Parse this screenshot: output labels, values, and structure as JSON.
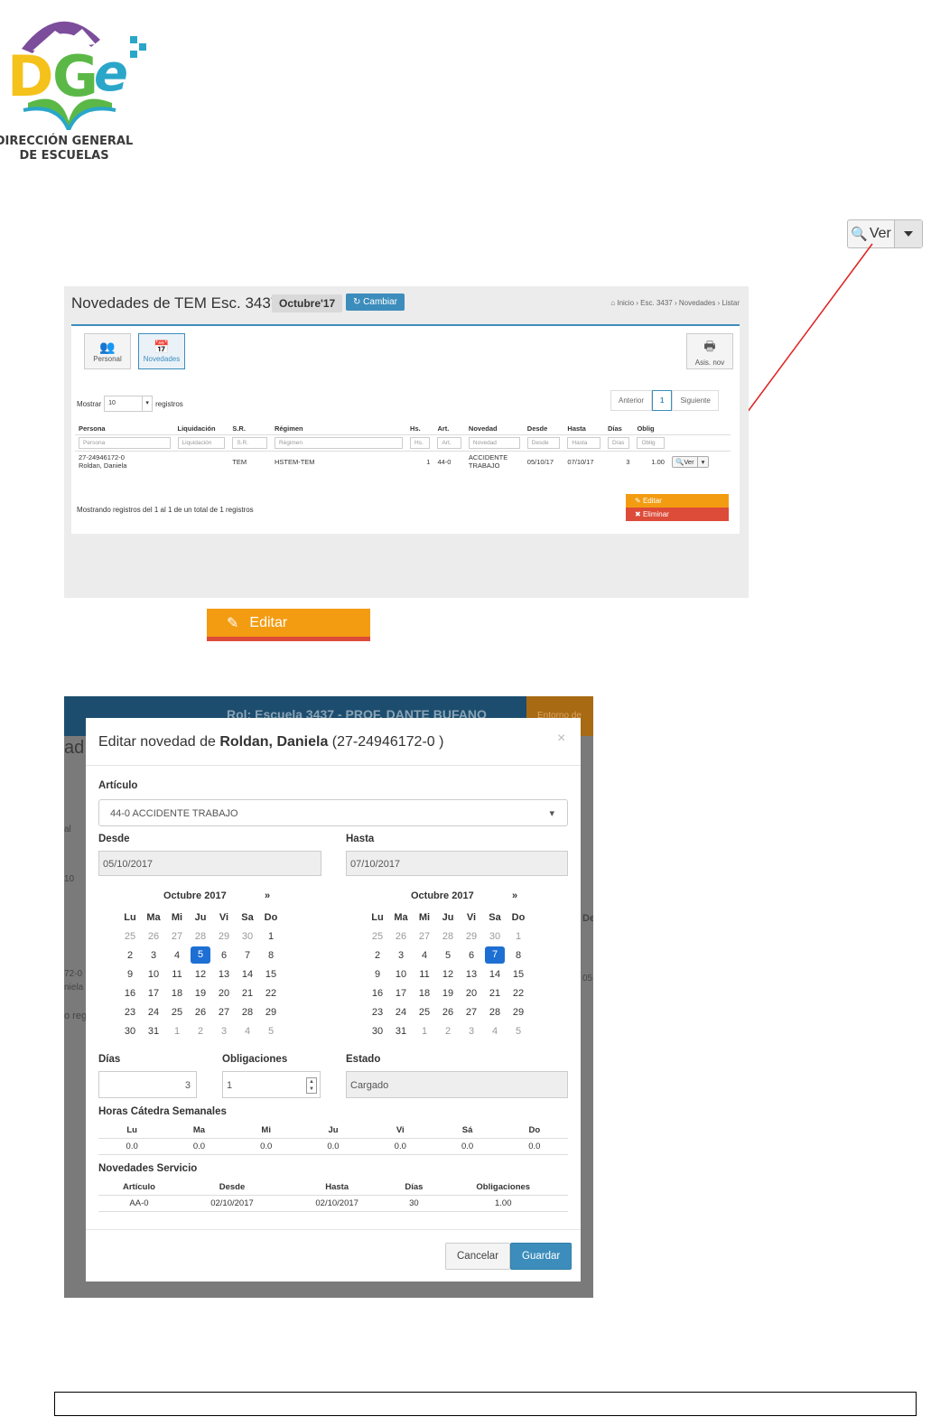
{
  "logo": {
    "line1": "DIRECCIÓN GENERAL",
    "line2": "DE ESCUELAS",
    "mark": "DGe"
  },
  "ver_callout": {
    "label": "Ver",
    "icon": "search-icon",
    "caret": "caret-down-icon"
  },
  "shot1": {
    "title": "Novedades de TEM Esc. 3437 -",
    "month": "Octubre'17",
    "cambiar": "Cambiar",
    "breadcrumb": [
      "Inicio",
      "Esc. 3437",
      "Novedades",
      "Listar"
    ],
    "tools": [
      {
        "label": "Personal",
        "icon": "users-icon"
      },
      {
        "label": "Novedades",
        "icon": "calendar-icon"
      }
    ],
    "print": {
      "label": "Asis. nov",
      "icon": "print-icon"
    },
    "mostrar": "Mostrar",
    "mostrar_value": "10",
    "registros": "registros",
    "pager": {
      "prev": "Anterior",
      "page": "1",
      "next": "Siguiente"
    },
    "columns": [
      "Persona",
      "Liquidación",
      "S.R.",
      "Régimen",
      "Hs.",
      "Art.",
      "Novedad",
      "Desde",
      "Hasta",
      "Días",
      "Oblig"
    ],
    "filters": [
      "Persona",
      "Liquidación",
      "S.R.",
      "Régimen",
      "Hs.",
      "Art.",
      "Novedad",
      "Desde",
      "Hasta",
      "Días",
      "Oblig"
    ],
    "row": {
      "persona1": "27-24946172-0",
      "persona2": "Roldan, Daniela",
      "liquidacion": "",
      "sr": "TEM",
      "regimen": "HSTEM-TEM",
      "hs": "1",
      "art": "44-0",
      "novedad1": "ACCIDENTE",
      "novedad2": "TRABAJO",
      "desde": "05/10/17",
      "hasta": "07/10/17",
      "dias": "3",
      "oblig": "1.00",
      "ver": "Ver"
    },
    "summary": "Mostrando registros del 1 al 1 de un total de 1 registros",
    "dropdown": {
      "editar": "Editar",
      "eliminar": "Eliminar"
    }
  },
  "editar_big": {
    "label": "Editar",
    "icon": "pencil-icon"
  },
  "shot2": {
    "bg_header": "Rol: Escuela 3437 - PROF. DANTE BUFANO",
    "bg_right": "Entorno de",
    "modal_title_pre": "Editar novedad de ",
    "modal_title_name": "Roldan, Daniela",
    "modal_title_post": " (27-24946172-0 )",
    "articulo_label": "Artículo",
    "articulo_value": "44-0 ACCIDENTE TRABAJO",
    "desde_label": "Desde",
    "desde_value": "05/10/2017",
    "hasta_label": "Hasta",
    "hasta_value": "07/10/2017",
    "cal_month": "Octubre 2017",
    "cal_next": "»",
    "weekdays": [
      "Lu",
      "Ma",
      "Mi",
      "Ju",
      "Vi",
      "Sa",
      "Do"
    ],
    "dias_label": "Días",
    "dias_value": "3",
    "oblig_label": "Obligaciones",
    "oblig_value": "1",
    "estado_label": "Estado",
    "estado_value": "Cargado",
    "horas_label": "Horas Cátedra Semanales",
    "horas_cols": [
      "Lu",
      "Ma",
      "Mi",
      "Ju",
      "Vi",
      "Sá",
      "Do"
    ],
    "horas_vals": [
      "0.0",
      "0.0",
      "0.0",
      "0.0",
      "0.0",
      "0.0",
      "0.0"
    ],
    "serv_label": "Novedades Servicio",
    "serv_cols": [
      "Artículo",
      "Desde",
      "Hasta",
      "Días",
      "Obligaciones"
    ],
    "serv_row": [
      "AA-0",
      "02/10/2017",
      "02/10/2017",
      "30",
      "1.00"
    ],
    "cancelar": "Cancelar",
    "guardar": "Guardar",
    "bg_frag": [
      "ad",
      "al",
      "10",
      "72-0",
      "niela",
      "o reg",
      "De",
      "05"
    ]
  },
  "colors": {
    "primary": "#3c8dbc",
    "warning": "#f39c12",
    "danger": "#dd4b39",
    "selected": "#1e6fd4",
    "callout_line": "#e02020"
  }
}
